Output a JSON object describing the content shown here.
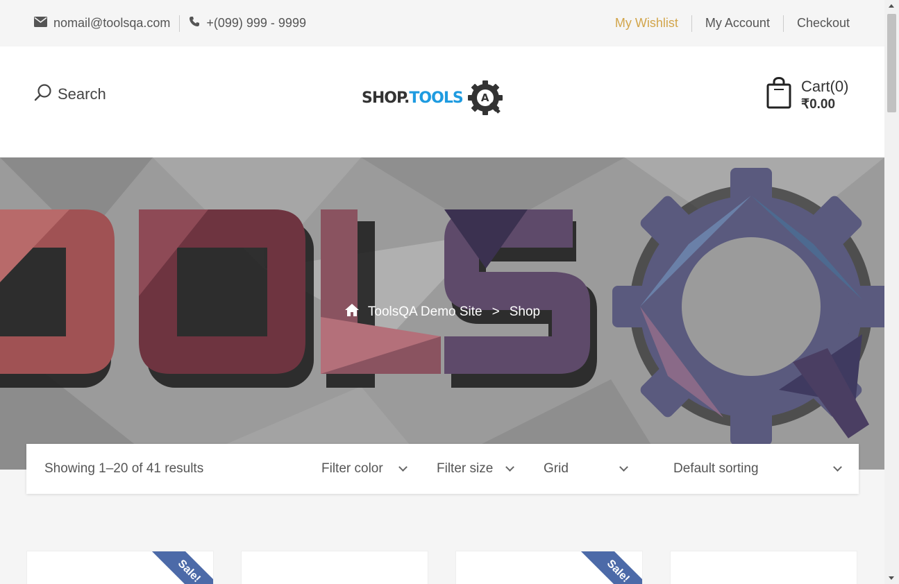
{
  "topbar": {
    "email": "nomail@toolsqa.com",
    "phone": "+(099) 999 - 9999",
    "links": [
      "My Wishlist",
      "My Account",
      "Checkout"
    ],
    "accent_color": "#d2a54b"
  },
  "header": {
    "search_label": "Search",
    "logo": {
      "word1": "SHOP.",
      "word2": "TOOLS",
      "badge": "A"
    },
    "cart": {
      "label": "Cart(0)",
      "total": "₹0.00"
    }
  },
  "hero": {
    "breadcrumb": {
      "home": "ToolsQA Demo Site",
      "separator": ">",
      "current": "Shop"
    }
  },
  "shop_toolbar": {
    "results": "Showing 1–20 of 41 results",
    "filter_color": "Filter color",
    "filter_size": "Filter size",
    "view": "Grid",
    "sorting": "Default sorting"
  },
  "products": [
    {
      "badge": "Sale!"
    },
    {
      "badge": ""
    },
    {
      "badge": "Sale!"
    },
    {
      "badge": ""
    }
  ],
  "colors": {
    "sale_badge": "#4c6aa8",
    "logo_blue": "#1e9be0"
  }
}
